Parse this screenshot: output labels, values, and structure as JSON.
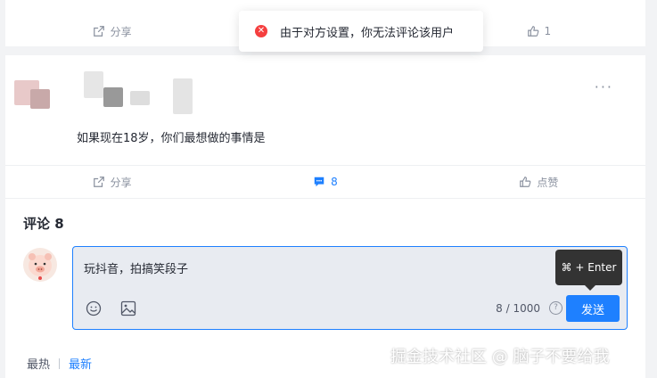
{
  "top_card": {
    "share_label": "分享",
    "like_count": "1"
  },
  "toast": {
    "message": "由于对方设置，你无法评论该用户"
  },
  "post": {
    "more_label": "···",
    "text": "如果现在18岁，你们最想做的事情是",
    "share_label": "分享",
    "comment_count": "8",
    "like_label": "点赞"
  },
  "comments": {
    "title": "评论 8",
    "editor_text": "玩抖音，拍搞笑段子",
    "char_count": "8 / 1000",
    "help_label": "?",
    "send_label": "发送",
    "shortcut_tooltip": "⌘ + Enter",
    "sort_hot": "最热",
    "sort_new": "最新"
  },
  "watermark": "掘金技术社区 @ 脑子不要给我",
  "colors": {
    "accent": "#1e80ff",
    "error": "#f53f3f"
  }
}
